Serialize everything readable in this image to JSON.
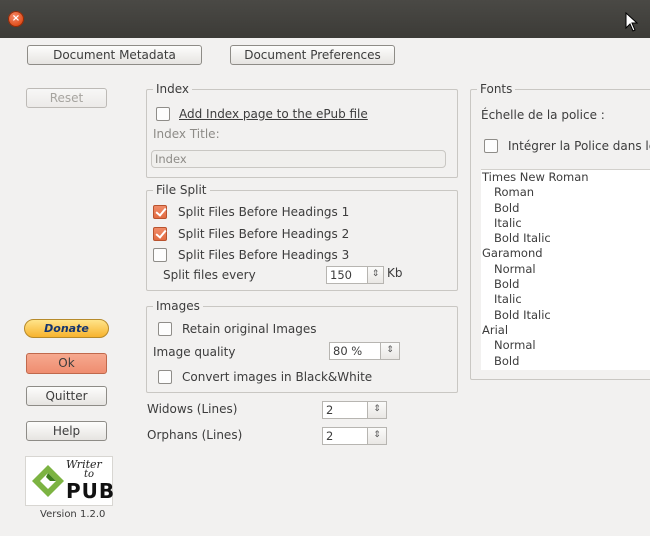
{
  "window": {
    "close_glyph": "×"
  },
  "top_buttons": {
    "metadata": "Document Metadata",
    "preferences": "Document Preferences"
  },
  "left": {
    "reset": "Reset",
    "donate": "Donate",
    "ok": "Ok",
    "quit": "Quitter",
    "help": "Help",
    "logo_line1": "Writer",
    "logo_line2": "to",
    "logo_line3": "PUB",
    "version": "Version 1.2.0"
  },
  "index": {
    "legend": "Index",
    "add_page_label": "Add Index page to the ePub file",
    "add_page_checked": false,
    "title_label": "Index Title:",
    "title_value": "Index"
  },
  "file_split": {
    "legend": "File Split",
    "h1_label": "Split Files Before Headings 1",
    "h1_checked": true,
    "h2_label": "Split Files Before Headings 2",
    "h2_checked": true,
    "h3_label": "Split Files Before Headings 3",
    "h3_checked": false,
    "every_label": "Split files every",
    "every_value": "150",
    "every_unit": "Kb"
  },
  "images": {
    "legend": "Images",
    "retain_label": "Retain original Images",
    "retain_checked": false,
    "quality_label": "Image quality",
    "quality_value": "80 %",
    "bw_label": "Convert images in Black&White",
    "bw_checked": false
  },
  "widows": {
    "label": "Widows (Lines)",
    "value": "2"
  },
  "orphans": {
    "label": "Orphans (Lines)",
    "value": "2"
  },
  "spin_glyph": "⇕",
  "fonts": {
    "legend": "Fonts",
    "scale_label": "Échelle de la police :",
    "embed_label": "Intégrer la Police dans le",
    "embed_checked": false,
    "list": [
      {
        "text": "Times New Roman",
        "type": "family"
      },
      {
        "text": "Roman",
        "type": "style"
      },
      {
        "text": "Bold",
        "type": "style"
      },
      {
        "text": "Italic",
        "type": "style"
      },
      {
        "text": "Bold Italic",
        "type": "style"
      },
      {
        "text": "Garamond",
        "type": "family"
      },
      {
        "text": "Normal",
        "type": "style"
      },
      {
        "text": "Bold",
        "type": "style"
      },
      {
        "text": "Italic",
        "type": "style"
      },
      {
        "text": "Bold Italic",
        "type": "style"
      },
      {
        "text": "Arial",
        "type": "family"
      },
      {
        "text": "Normal",
        "type": "style"
      },
      {
        "text": "Bold",
        "type": "style"
      }
    ]
  }
}
